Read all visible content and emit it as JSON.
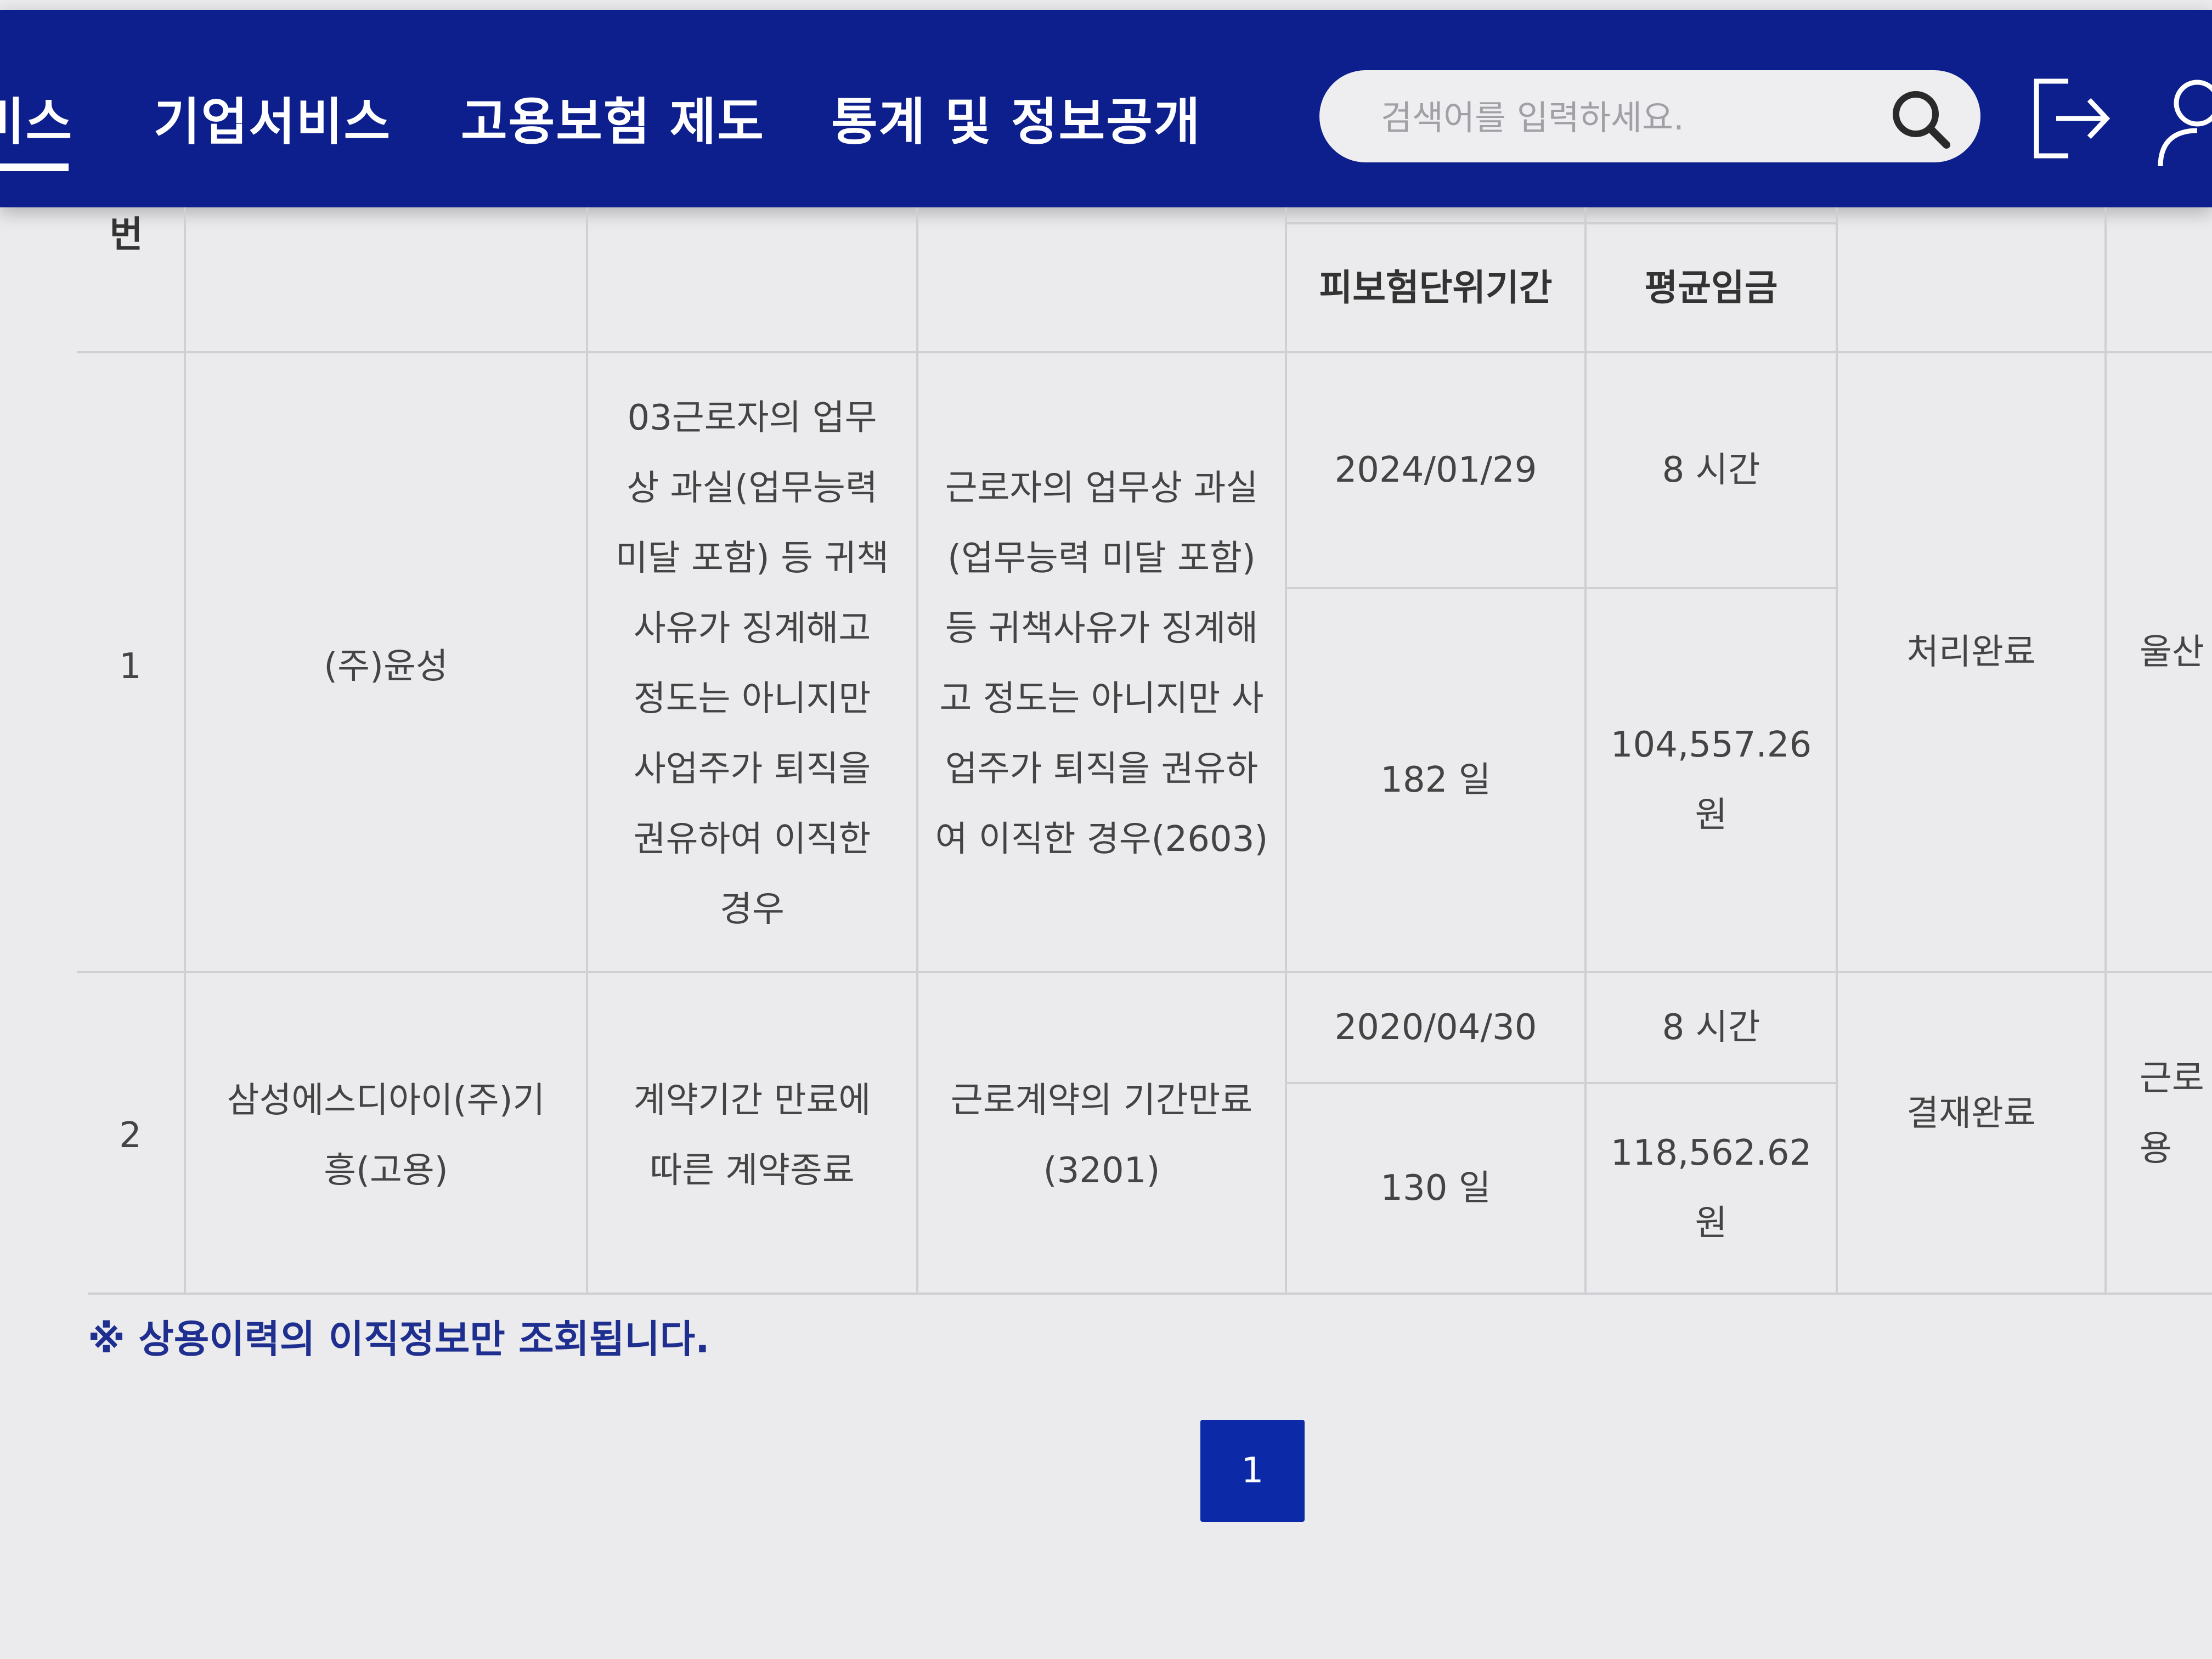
{
  "header": {
    "nav": [
      {
        "label": "비스"
      },
      {
        "label": "기업서비스"
      },
      {
        "label": "고용보험 제도"
      },
      {
        "label": "통계 및 정보공개"
      }
    ],
    "search": {
      "placeholder": "검색어를 입력하세요."
    },
    "icons": {
      "search": "search-icon",
      "logout": "logout-icon",
      "user": "user-icon"
    }
  },
  "table": {
    "header_partial_no": "번",
    "sub_headers": {
      "period": "피보험단위기간",
      "wage": "평균임금"
    },
    "rows": [
      {
        "no": "1",
        "company": "(주)윤성",
        "reason_lines": [
          "03근로자의 업무",
          "상 과실(업무능력",
          "미달 포함) 등 귀책",
          "사유가 징계해고",
          "정도는 아니지만",
          "사업주가 퇴직을",
          "권유하여 이직한",
          "경우"
        ],
        "reason_code_lines": [
          "근로자의 업무상 과실",
          "(업무능력 미달 포함)",
          "등 귀책사유가 징계해",
          "고 정도는 아니지만 사",
          "업주가 퇴직을 권유하",
          "여 이직한 경우(2603)"
        ],
        "date": "2024/01/29",
        "hours": "8 시간",
        "days": "182 일",
        "wage_lines": [
          "104,557.26",
          "원"
        ],
        "status": "처리완료",
        "office_partial": "울산"
      },
      {
        "no": "2",
        "company_lines": [
          "삼성에스디아이(주)기",
          "흥(고용)"
        ],
        "reason_lines": [
          "계약기간 만료에",
          "따른 계약종료"
        ],
        "reason_code_lines": [
          "근로계약의 기간만료",
          "(3201)"
        ],
        "date": "2020/04/30",
        "hours": "8 시간",
        "days": "130 일",
        "wage_lines": [
          "118,562.62",
          "원"
        ],
        "status": "결재완료",
        "office_partial_lines": [
          "근로",
          "용"
        ]
      }
    ]
  },
  "note": "※ 상용이력의 이직정보만 조회됩니다.",
  "pagination": {
    "current": "1"
  },
  "colors": {
    "header_bg": "#0d1f8c",
    "page_btn": "#0c29a8",
    "note": "#1f2f8f"
  }
}
